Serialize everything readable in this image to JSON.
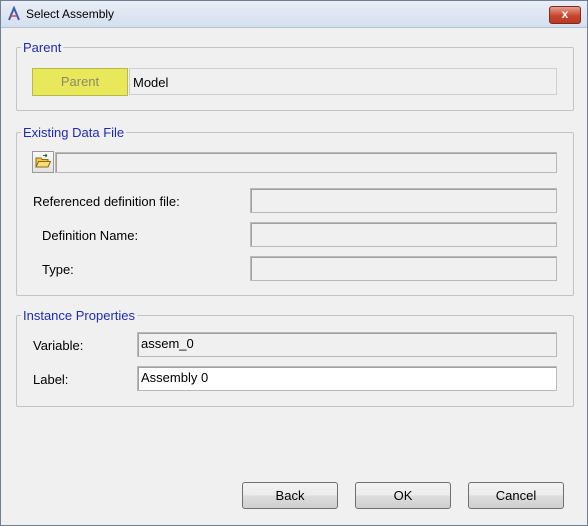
{
  "window": {
    "title": "Select Assembly",
    "close_glyph": "x",
    "app_icon": "altair-logo-icon"
  },
  "parent_group": {
    "title": "Parent",
    "button_label": "Parent",
    "value": "Model"
  },
  "data_file_group": {
    "title": "Existing Data File",
    "file_path": "",
    "fields": [
      {
        "label": "Referenced definition file:",
        "value": ""
      },
      {
        "label": "Definition Name:",
        "value": ""
      },
      {
        "label": "Type:",
        "value": ""
      }
    ]
  },
  "instance_group": {
    "title": "Instance Properties",
    "variable_label": "Variable:",
    "variable_value": "assem_0",
    "label_label": "Label:",
    "label_value": "Assembly 0"
  },
  "buttons": {
    "back": "Back",
    "ok": "OK",
    "cancel": "Cancel"
  },
  "colors": {
    "group_title": "#1f2ab8",
    "parent_button": "#e8e85a"
  }
}
